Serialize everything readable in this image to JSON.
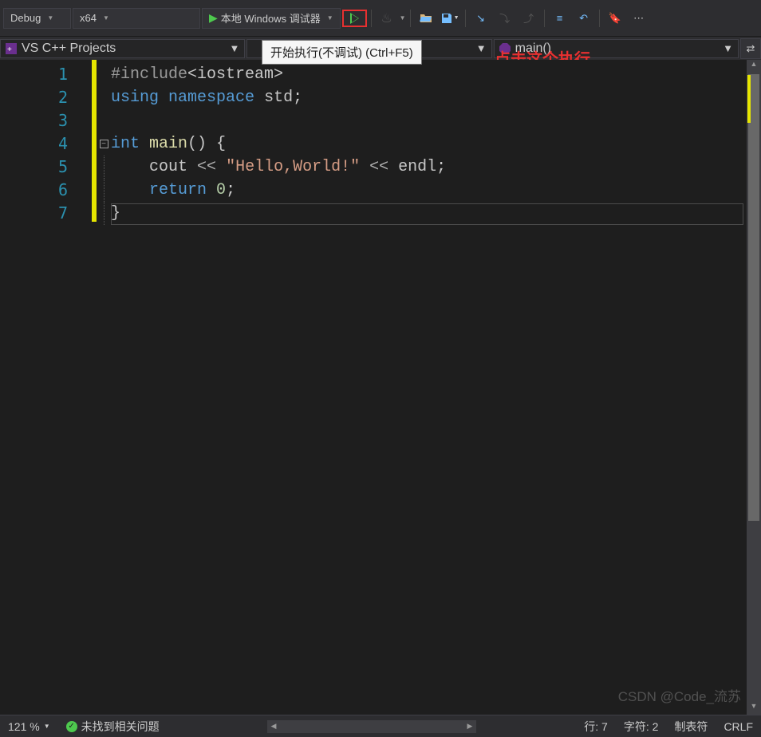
{
  "toolbar": {
    "config": "Debug",
    "platform": "x64",
    "debugger_label": "本地 Windows 调试器",
    "tooltip": "开始执行(不调试) (Ctrl+F5)"
  },
  "subbar": {
    "scope": "VS C++ Projects",
    "middle": "",
    "function": "main()"
  },
  "annotation": "点击这个执行",
  "code_lines": [
    {
      "n": 1,
      "mod": true,
      "fold": "",
      "tokens": [
        [
          "k-prep",
          "#include"
        ],
        [
          "k-punc",
          "<"
        ],
        [
          "k-id",
          "iostream"
        ],
        [
          "k-punc",
          ">"
        ]
      ]
    },
    {
      "n": 2,
      "mod": true,
      "fold": "",
      "tokens": [
        [
          "k-blue",
          "using"
        ],
        [
          "k-punc",
          " "
        ],
        [
          "k-blue",
          "namespace"
        ],
        [
          "k-punc",
          " "
        ],
        [
          "k-id",
          "std"
        ],
        [
          "k-punc",
          ";"
        ]
      ]
    },
    {
      "n": 3,
      "mod": true,
      "fold": "",
      "tokens": []
    },
    {
      "n": 4,
      "mod": true,
      "fold": "box",
      "tokens": [
        [
          "k-blue",
          "int"
        ],
        [
          "k-punc",
          " "
        ],
        [
          "k-func",
          "main"
        ],
        [
          "k-punc",
          "() {"
        ]
      ]
    },
    {
      "n": 5,
      "mod": true,
      "fold": "line",
      "tokens": [
        [
          "k-punc",
          "    "
        ],
        [
          "k-id",
          "cout"
        ],
        [
          "k-punc",
          " "
        ],
        [
          "k-op",
          "<<"
        ],
        [
          "k-punc",
          " "
        ],
        [
          "k-str",
          "\"Hello,World!\""
        ],
        [
          "k-punc",
          " "
        ],
        [
          "k-op",
          "<<"
        ],
        [
          "k-punc",
          " "
        ],
        [
          "k-id",
          "endl"
        ],
        [
          "k-punc",
          ";"
        ]
      ]
    },
    {
      "n": 6,
      "mod": true,
      "fold": "line",
      "tokens": [
        [
          "k-punc",
          "    "
        ],
        [
          "k-blue",
          "return"
        ],
        [
          "k-punc",
          " "
        ],
        [
          "k-num",
          "0"
        ],
        [
          "k-punc",
          ";"
        ]
      ]
    },
    {
      "n": 7,
      "mod": true,
      "fold": "line",
      "tokens": [
        [
          "k-punc",
          "}"
        ]
      ]
    }
  ],
  "status": {
    "zoom": "121 %",
    "issues": "未找到相关问题",
    "line": "行: 7",
    "char": "字符: 2",
    "tabs": "制表符",
    "eol": "CRLF"
  },
  "watermark": "CSDN @Code_流苏"
}
